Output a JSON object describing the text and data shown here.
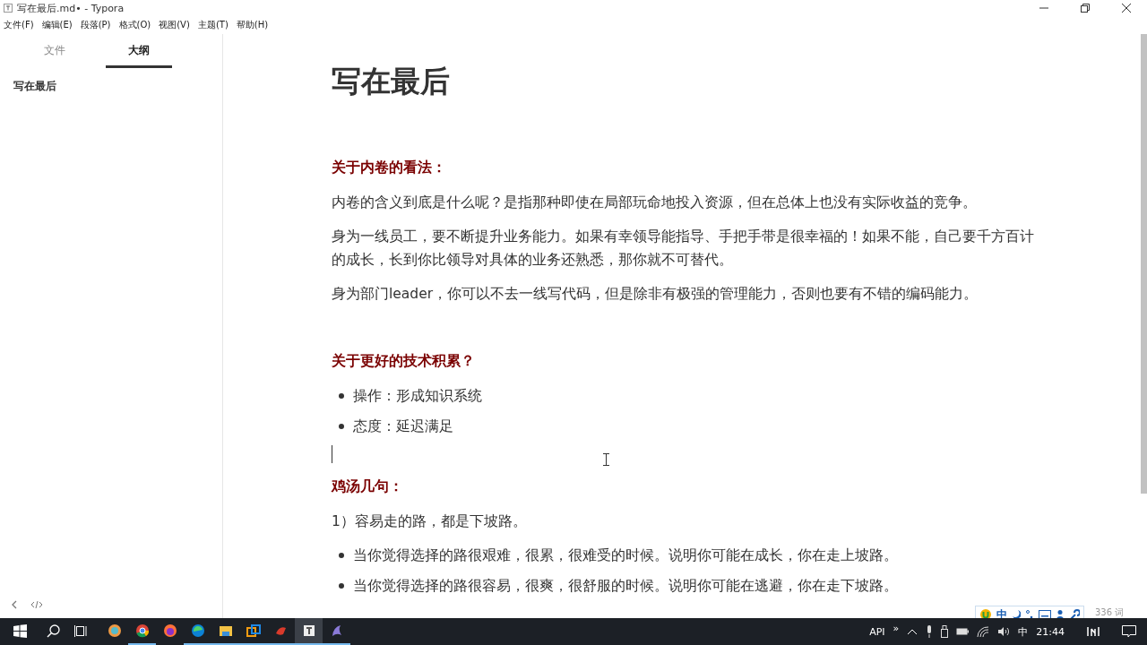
{
  "window": {
    "title": "写在最后.md• - Typora"
  },
  "menu": [
    "文件(F)",
    "编辑(E)",
    "段落(P)",
    "格式(O)",
    "视图(V)",
    "主题(T)",
    "帮助(H)"
  ],
  "sidebar": {
    "tabs": [
      {
        "label": "文件",
        "selected": false
      },
      {
        "label": "大纲",
        "selected": true
      }
    ],
    "outline": [
      {
        "label": "写在最后",
        "selected": false
      }
    ]
  },
  "document": {
    "title": "写在最后",
    "blocks": [
      {
        "kind": "heading",
        "text": "关于内卷的看法："
      },
      {
        "kind": "paragraph",
        "text": "内卷的含义到底是什么呢？是指那种即使在局部玩命地投入资源，但在总体上也没有实际收益的竞争。"
      },
      {
        "kind": "paragraph",
        "text": "身为一线员工，要不断提升业务能力。如果有幸领导能指导、手把手带是很幸福的！如果不能，自己要千方百计的成长，长到你比领导对具体的业务还熟悉，那你就不可替代。"
      },
      {
        "kind": "paragraph",
        "text": "身为部门leader，你可以不去一线写代码，但是除非有极强的管理能力，否则也要有不错的编码能力。"
      },
      {
        "kind": "heading",
        "text": "关于更好的技术积累？"
      },
      {
        "kind": "bullet",
        "text": "操作：形成知识系统"
      },
      {
        "kind": "bullet",
        "text": "态度：延迟满足"
      },
      {
        "kind": "cursor"
      },
      {
        "kind": "heading",
        "text": "鸡汤几句："
      },
      {
        "kind": "paragraph",
        "text": "1）容易走的路，都是下坡路。"
      },
      {
        "kind": "bullet",
        "text": "当你觉得选择的路很艰难，很累，很难受的时候。说明你可能在成长，你在走上坡路。"
      },
      {
        "kind": "bullet",
        "text": "当你觉得选择的路很容易，很爽，很舒服的时候。说明你可能在逃避，你在走下坡路。"
      }
    ]
  },
  "ime": {
    "label": "中"
  },
  "word_count": "336 词",
  "taskbar": {
    "apps": [
      {
        "kind": "ring",
        "running": false,
        "active": false
      },
      {
        "kind": "chrome",
        "running": true,
        "active": false
      },
      {
        "kind": "firefox",
        "running": false,
        "active": false
      },
      {
        "kind": "edge",
        "running": true,
        "active": false
      },
      {
        "kind": "folder",
        "running": true,
        "active": false
      },
      {
        "kind": "squares",
        "running": true,
        "active": false
      },
      {
        "kind": "bird",
        "running": true,
        "active": false
      },
      {
        "kind": "typora",
        "running": true,
        "active": true
      },
      {
        "kind": "dolphin",
        "running": true,
        "active": false
      }
    ],
    "tray_label": "API",
    "chevron": "»",
    "ime": "中",
    "time": "21:44"
  }
}
